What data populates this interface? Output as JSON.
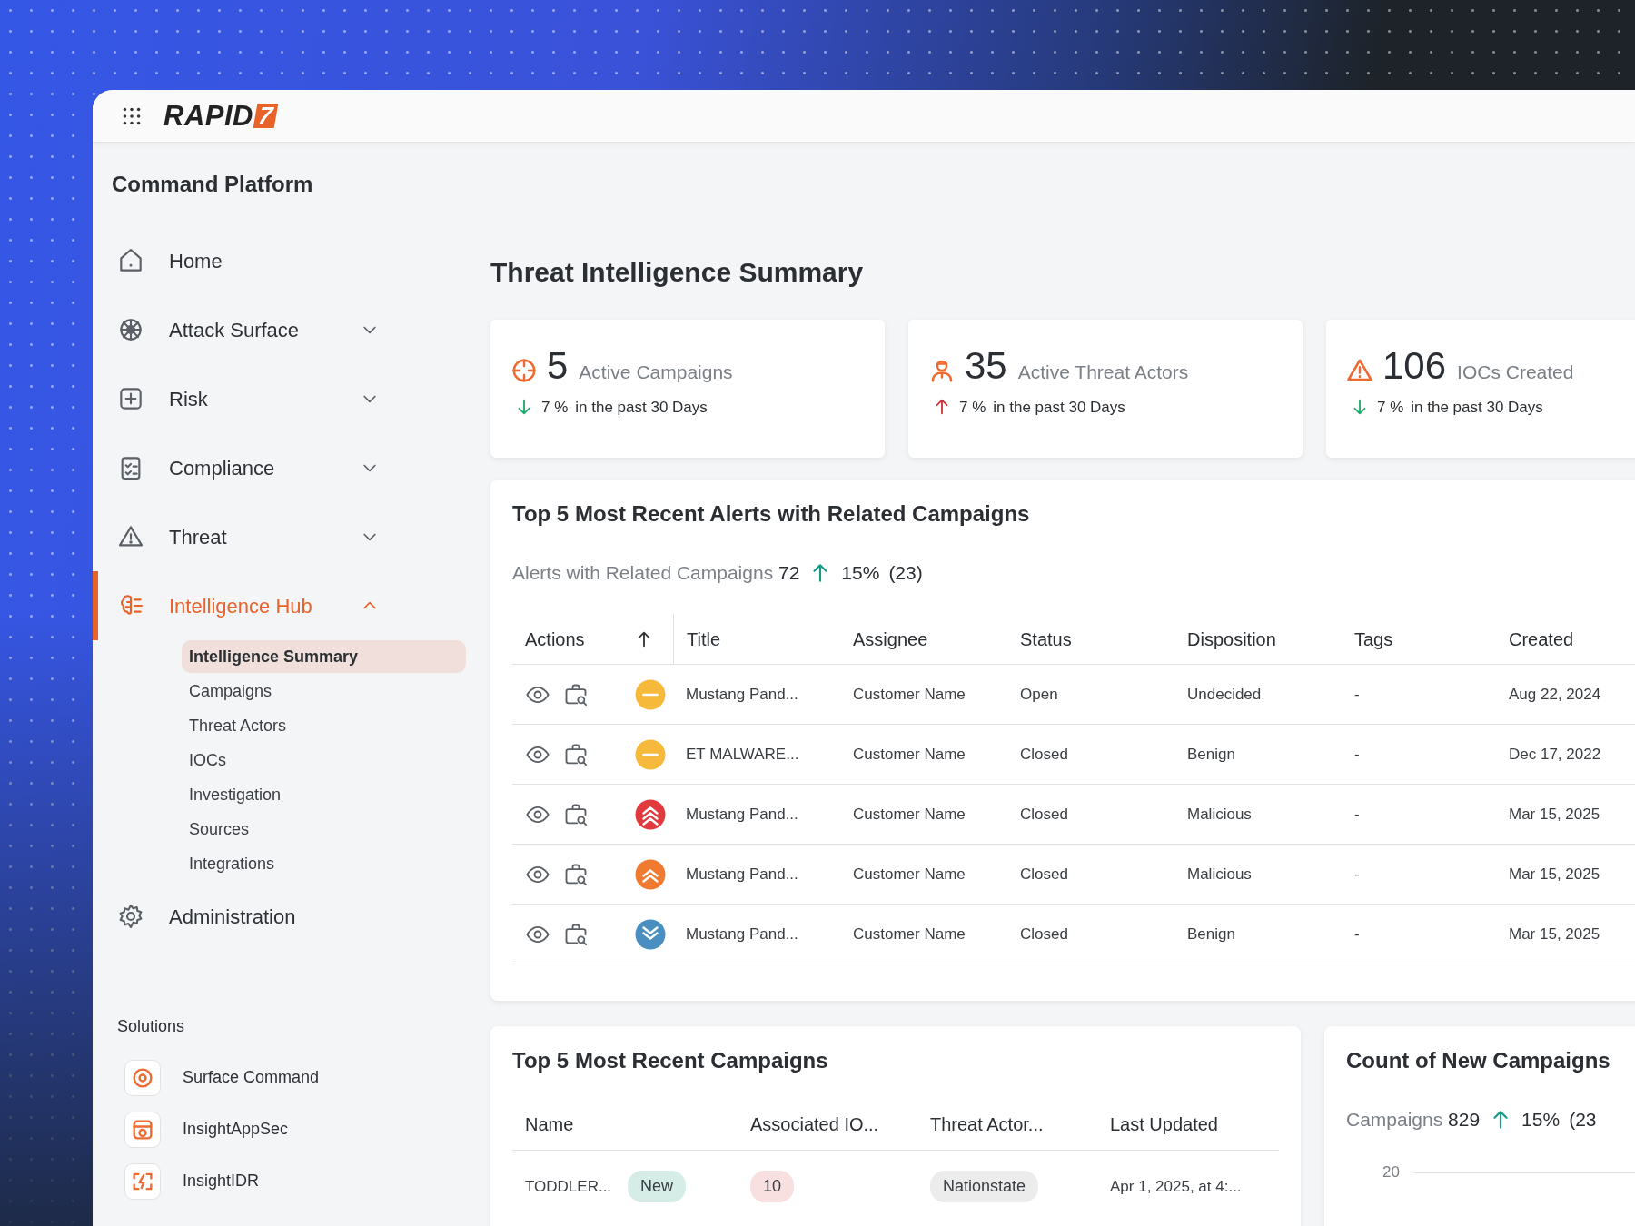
{
  "header": {
    "logo": {
      "text": "RAPID",
      "mark": "7"
    }
  },
  "sidebar": {
    "title": "Command Platform",
    "items": [
      {
        "label": "Home",
        "selected": false
      },
      {
        "label": "Attack Surface",
        "selected": false,
        "expanded": false
      },
      {
        "label": "Risk",
        "selected": false,
        "expanded": false
      },
      {
        "label": "Compliance",
        "selected": false,
        "expanded": false
      },
      {
        "label": "Threat",
        "selected": false,
        "expanded": false
      },
      {
        "label": "Intelligence Hub",
        "selected": true,
        "expanded": true,
        "children": [
          {
            "label": "Intelligence Summary",
            "selected": true
          },
          {
            "label": "Campaigns",
            "selected": false
          },
          {
            "label": "Threat Actors",
            "selected": false
          },
          {
            "label": "IOCs",
            "selected": false
          },
          {
            "label": "Investigation",
            "selected": false
          },
          {
            "label": "Sources",
            "selected": false
          },
          {
            "label": "Integrations",
            "selected": false
          }
        ]
      },
      {
        "label": "Administration",
        "selected": false
      }
    ],
    "solutions": {
      "title": "Solutions",
      "items": [
        {
          "label": "Surface Command"
        },
        {
          "label": "InsightAppSec"
        },
        {
          "label": "InsightIDR"
        }
      ]
    }
  },
  "page_title": "Threat Intelligence Summary",
  "kpis": [
    {
      "value": "5",
      "label": "Active Campaigns",
      "kind": "down",
      "change": "7 %",
      "period": "in the past 30 Days"
    },
    {
      "value": "35",
      "label": "Active Threat Actors",
      "kind": "up",
      "change": "7 %",
      "period": "in the past 30 Days"
    },
    {
      "value": "106",
      "label": "IOCs Created",
      "kind": "down",
      "change": "7 %",
      "period": "in the past 30 Days"
    }
  ],
  "alerts": {
    "title": "Top 5 Most Recent Alerts with Related Campaigns",
    "summary": {
      "label": "Alerts with Related Campaigns",
      "value": "72",
      "kind": "up",
      "change": "15%",
      "delta": "(23)"
    },
    "columns": [
      "Actions",
      "Title",
      "Assignee",
      "Status",
      "Disposition",
      "Tags",
      "Created"
    ],
    "rows": [
      {
        "kind": "neutral",
        "color": "#f6b93b",
        "title": "Mustang Pand...",
        "assignee": "Customer Name",
        "status": "Open",
        "disposition": "Undecided",
        "tags": "-",
        "created": "Aug 22, 2024"
      },
      {
        "kind": "neutral",
        "color": "#f6b93b",
        "title": "ET MALWARE...",
        "assignee": "Customer Name",
        "status": "Closed",
        "disposition": "Benign",
        "tags": "-",
        "created": "Dec 17, 2022"
      },
      {
        "kind": "critical",
        "color": "#e0393e",
        "title": "Mustang Pand...",
        "assignee": "Customer Name",
        "status": "Closed",
        "disposition": "Malicious",
        "tags": "-",
        "created": "Mar 15, 2025"
      },
      {
        "kind": "high",
        "color": "#f07a30",
        "title": "Mustang Pand...",
        "assignee": "Customer Name",
        "status": "Closed",
        "disposition": "Malicious",
        "tags": "-",
        "created": "Mar 15, 2025"
      },
      {
        "kind": "low",
        "color": "#4a8fc0",
        "title": "Mustang Pand...",
        "assignee": "Customer Name",
        "status": "Closed",
        "disposition": "Benign",
        "tags": "-",
        "created": "Mar 15, 2025"
      }
    ]
  },
  "campaigns": {
    "title": "Top 5 Most Recent Campaigns",
    "columns": [
      "Name",
      "Associated IO...",
      "Threat Actor...",
      "Last Updated"
    ],
    "rows": [
      {
        "name": "TODDLER...",
        "badge": "New",
        "iocs": "10",
        "actor": "Nationstate",
        "updated": "Apr 1, 2025, at 4:..."
      }
    ]
  },
  "count": {
    "title": "Count of New Campaigns",
    "summary": {
      "label": "Campaigns",
      "value": "829",
      "kind": "up",
      "change": "15%",
      "delta": "(23"
    },
    "tick": "20"
  }
}
